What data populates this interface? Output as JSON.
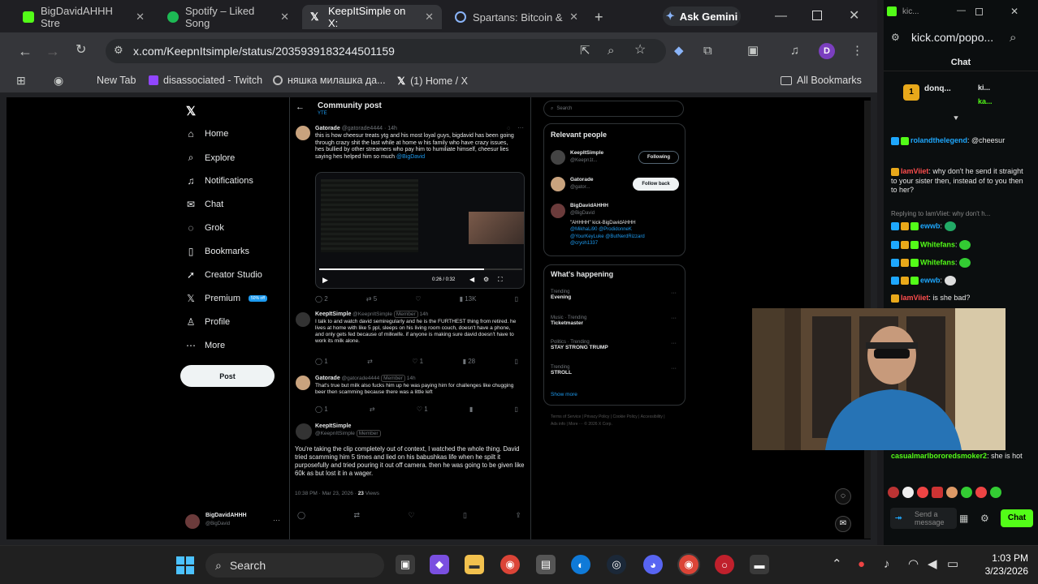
{
  "browser": {
    "tabs": [
      {
        "title": "BigDavidAHHH Stre",
        "color": "#53fc18"
      },
      {
        "title": "Spotify – Liked Song",
        "color": "#1db954"
      },
      {
        "title": "KeepItSimple on X:",
        "color": "#ffffff"
      },
      {
        "title": "Spartans: Bitcoin &",
        "color": "#8ab4f8"
      }
    ],
    "ask_gemini": "Ask Gemini",
    "url": "x.com/KeepnItsimple/status/2035939183244501159",
    "profile_initial": "D",
    "bookmarks": [
      "New Tab",
      "disassociated - Twitch",
      "няшка милашка да...",
      "(1) Home / X"
    ],
    "all_bookmarks": "All Bookmarks"
  },
  "x": {
    "nav": [
      "Home",
      "Explore",
      "Notifications",
      "Chat",
      "Grok",
      "Bookmarks",
      "Creator Studio",
      "Premium",
      "Profile",
      "More"
    ],
    "premium_badge": "50% off",
    "post_button": "Post",
    "account": {
      "name": "BigDavidAHHH",
      "handle": "@BigDavid"
    },
    "header": {
      "title": "Community post",
      "subtitle": "YTE"
    },
    "search_placeholder": "Search",
    "tweets": [
      {
        "name": "Gatorade",
        "handle": "@gatorade4444 · 14h",
        "text": "this is how cheesur treats ytg and his most loyal guys, bigdavid has been going through crazy shit the last while at home w his family who have crazy issues, hes bullied by other streamers who pay him to humiliate himself, cheesur lies saying hes helped him so much",
        "mention": "@BigDavid"
      },
      {
        "name": "KeepItSimple",
        "handle": "@KeepnItSimple",
        "badge": "Member",
        "time": "14h",
        "text": "I talk to and watch david semiregularly and he is the FURTHEST thing from retired. he lives at home with like 5 ppl, sleeps on his living room couch, doesn't have a phone, and only gets fed because of milkwife. if anyone is making sure david doesn't have to work its milk alone."
      },
      {
        "name": "Gatorade",
        "handle": "@gatorade4444",
        "badge": "Member",
        "time": "14h",
        "text": "That's true but milk also fucks him up he was paying him for challenges like chugging beer then scamming because there was a little left"
      },
      {
        "name": "KeepItSimple",
        "handle": "@KeepnItSimple",
        "badge": "Member",
        "text": "You're taking the clip completely out of context, I watched the whole thing. David tried scamming him 5 times and lied on his babushkas life when he spilt it purposefully and tried pouring it out off camera. then he was going to be given like 60k as but lost it in a wager.",
        "meta": "10:38 PM · Mar 23, 2026 · ",
        "views": "23",
        "views_label": "Views"
      }
    ],
    "video_time": "0:26 / 0:32",
    "tweet_counts": {
      "t1": [
        "2",
        "5",
        "13K"
      ],
      "t2": [
        "1",
        "1",
        "28"
      ],
      "t3": [
        "1",
        "1"
      ]
    },
    "relevant_people_title": "Relevant people",
    "people": [
      {
        "name": "KeepItSimple",
        "handle": "@Keepn1t...",
        "btn": "Following"
      },
      {
        "name": "Gatorade",
        "handle": "@gator...",
        "btn": "Follow back"
      },
      {
        "name": "BigDavidAHHH",
        "handle": "@BigDavid",
        "bio1": "\"AHHHH\" kick-BigDavidAHHH",
        "bio2": "@MikhaLi90 @ProdidonneK",
        "bio3": "@YourKeyLuke @ButNerdRizzard",
        "bio4": "@cryoh1337"
      }
    ],
    "happening_title": "What's happening",
    "trends": [
      {
        "ctx": "Trending",
        "name": "Evening"
      },
      {
        "ctx": "Music · Trending",
        "name": "Ticketmaster"
      },
      {
        "ctx": "Politics · Trending",
        "name": "STAY STRONG TRUMP"
      },
      {
        "ctx": "Trending",
        "name": "STROLL"
      }
    ],
    "show_more": "Show more",
    "footer": "Terms of Service | Privacy Policy | Cookie Policy | Accessibility | Ads info | More ··· © 2026 X Corp."
  },
  "kick": {
    "url": "kick.com/popo...",
    "tab_title": "kic...",
    "chat_title": "Chat",
    "leaders": [
      "donq...",
      "ki...",
      "ka..."
    ],
    "messages": [
      {
        "user": "rolandthelegend",
        "text": "@cheesur",
        "color": "#1ea7fd"
      },
      {
        "user": "IamViiet",
        "text": "why don't he send it straight to your sister then, instead of to you then to her?",
        "color": "#ff4d4d"
      },
      {
        "user": "",
        "text": "Replying to IamViiet: why don't h...",
        "color": "#888888"
      },
      {
        "user": "ewwb",
        "text": "",
        "color": "#1ea7fd"
      },
      {
        "user": "Whitefans",
        "text": "",
        "color": "#53fc18"
      },
      {
        "user": "Whitefans",
        "text": "",
        "color": "#53fc18"
      },
      {
        "user": "ewwb",
        "text": "",
        "color": "#1ea7fd"
      },
      {
        "user": "IamViiet",
        "text": "is she bad?",
        "color": "#ff4d4d"
      },
      {
        "user": "casualmarlbororedsmoker2",
        "text": "she is hot",
        "color": "#53fc18"
      }
    ],
    "send_placeholder": "Send a message",
    "chat_button": "Chat"
  },
  "taskbar": {
    "search": "Search",
    "time": "1:03 PM",
    "date": "3/23/2026"
  }
}
